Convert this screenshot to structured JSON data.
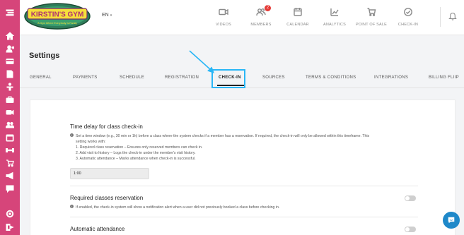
{
  "logo": {
    "text": "KIRSTIN'S GYM",
    "tagline": "A Gym Where Everybody Is Family"
  },
  "header": {
    "language": "EN",
    "nav": [
      {
        "label": "VIDEOS",
        "icon": "video-icon"
      },
      {
        "label": "MEMBERS",
        "icon": "members-icon",
        "badge": "2"
      },
      {
        "label": "CALENDAR",
        "icon": "calendar-icon"
      },
      {
        "label": "ANALYTICS",
        "icon": "analytics-icon"
      },
      {
        "label": "POINT OF SALE",
        "icon": "cart-icon"
      },
      {
        "label": "CHECK-IN",
        "icon": "check-in-icon"
      }
    ]
  },
  "page": {
    "title": "Settings"
  },
  "tabs": [
    {
      "label": "GENERAL"
    },
    {
      "label": "PAYMENTS"
    },
    {
      "label": "SCHEDULE"
    },
    {
      "label": "REGISTRATION"
    },
    {
      "label": "CHECK-IN",
      "active": true
    },
    {
      "label": "SOURCES"
    },
    {
      "label": "TERMS & CONDITIONS"
    },
    {
      "label": "INTEGRATIONS"
    },
    {
      "label": "BILLING FLIIP"
    }
  ],
  "sections": {
    "time_delay": {
      "title": "Time delay for class check-in",
      "desc_lines": [
        "Set a time window (e.g., 30 min or 1h) before a class where the system checks if a member has a reservation. If required, the check-in will only be allowed within this timeframe. This",
        "setting works with:",
        "1. Required class reservation – Ensures only reserved members can check in.",
        "2. Add visit to history – Logs the check-in under the member's visit history.",
        "3. Automatic attendance – Marks attendance when check-in is successful."
      ],
      "value": "1:00"
    },
    "required_reservation": {
      "title": "Required classes reservation",
      "desc": "If enabled, the check-in system will show a notification alert when a user did not previously booked a class before checking in.",
      "enabled": false
    },
    "automatic_attendance": {
      "title": "Automatic attendance",
      "enabled": false
    }
  },
  "colors": {
    "sidebar": "#d6457a",
    "highlight": "#29b6f6",
    "badge": "#e53935",
    "chat": "#1e88c9"
  }
}
